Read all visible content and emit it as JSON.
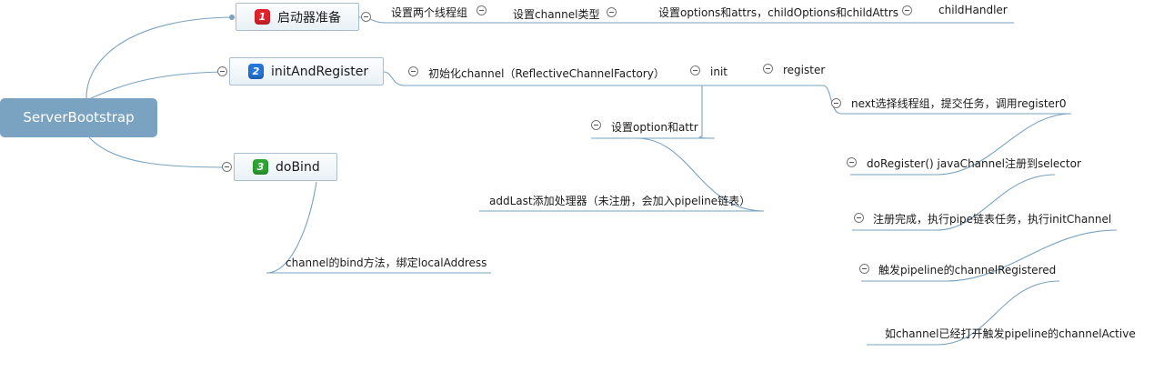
{
  "root": {
    "label": "ServerBootstrap"
  },
  "branches": [
    {
      "number": "1",
      "label": "启动器准备"
    },
    {
      "number": "2",
      "label": "initAndRegister"
    },
    {
      "number": "3",
      "label": "doBind"
    }
  ],
  "nodes": {
    "set_thread_groups": "设置两个线程组",
    "set_channel_type": "设置channel类型",
    "set_options": "设置options和attrs，childOptions和childAttrs",
    "child_handler": "childHandler",
    "init_channel": "初始化channel（ReflectiveChannelFactory）",
    "init": "init",
    "register": "register",
    "next_select": "next选择线程组，提交任务，调用register0",
    "do_register": "doRegister() javaChannel注册到selector",
    "register_done": "注册完成，执行pipe链表任务，执行initChannel",
    "fire_registered": "触发pipeline的channelRegistered",
    "fire_active": "如channel已经打开触发pipeline的channelActive",
    "set_option_attr": "设置option和attr",
    "add_last": "addLast添加处理器（未注册，会加入pipeline链表）",
    "channel_bind": "channel的bind方法，绑定localAddress"
  },
  "colors": {
    "root_bg": "#7aa3c2",
    "link": "#7aa3c2",
    "badge_red": "#e0232d",
    "badge_blue": "#2476d8",
    "badge_green": "#2ea534"
  }
}
